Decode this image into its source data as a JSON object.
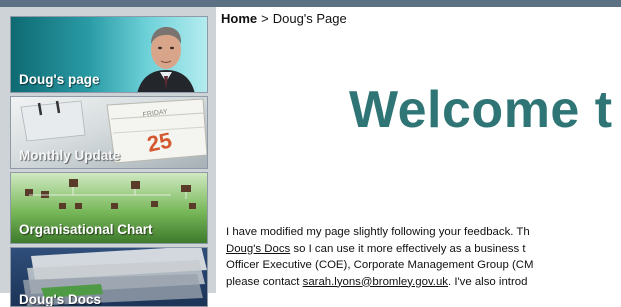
{
  "breadcrumb": {
    "home": "Home",
    "separator": ">",
    "current": "Doug's Page"
  },
  "sidebar": {
    "tiles": [
      {
        "label": "Doug's page"
      },
      {
        "label": "Monthly Update"
      },
      {
        "label": "Organisational Chart"
      },
      {
        "label": "Doug's Docs"
      }
    ]
  },
  "main": {
    "welcome_heading": "Welcome t",
    "paragraph": {
      "line1": "I have modified my page slightly following your feedback.  Th",
      "line2_link": "Doug's Docs",
      "line2_rest": " so I can use it more effectively as a business t",
      "line3": "Officer Executive (COE), Corporate Management Group (CM",
      "line4_pre": "please contact ",
      "line4_email": "sarah.lyons@bromley.gov.uk",
      "line4_post": ". I've also introd"
    }
  },
  "colors": {
    "top_rule": "#5d7185",
    "sidebar_bg": "#ced3d8",
    "welcome_heading": "#2f7575"
  }
}
